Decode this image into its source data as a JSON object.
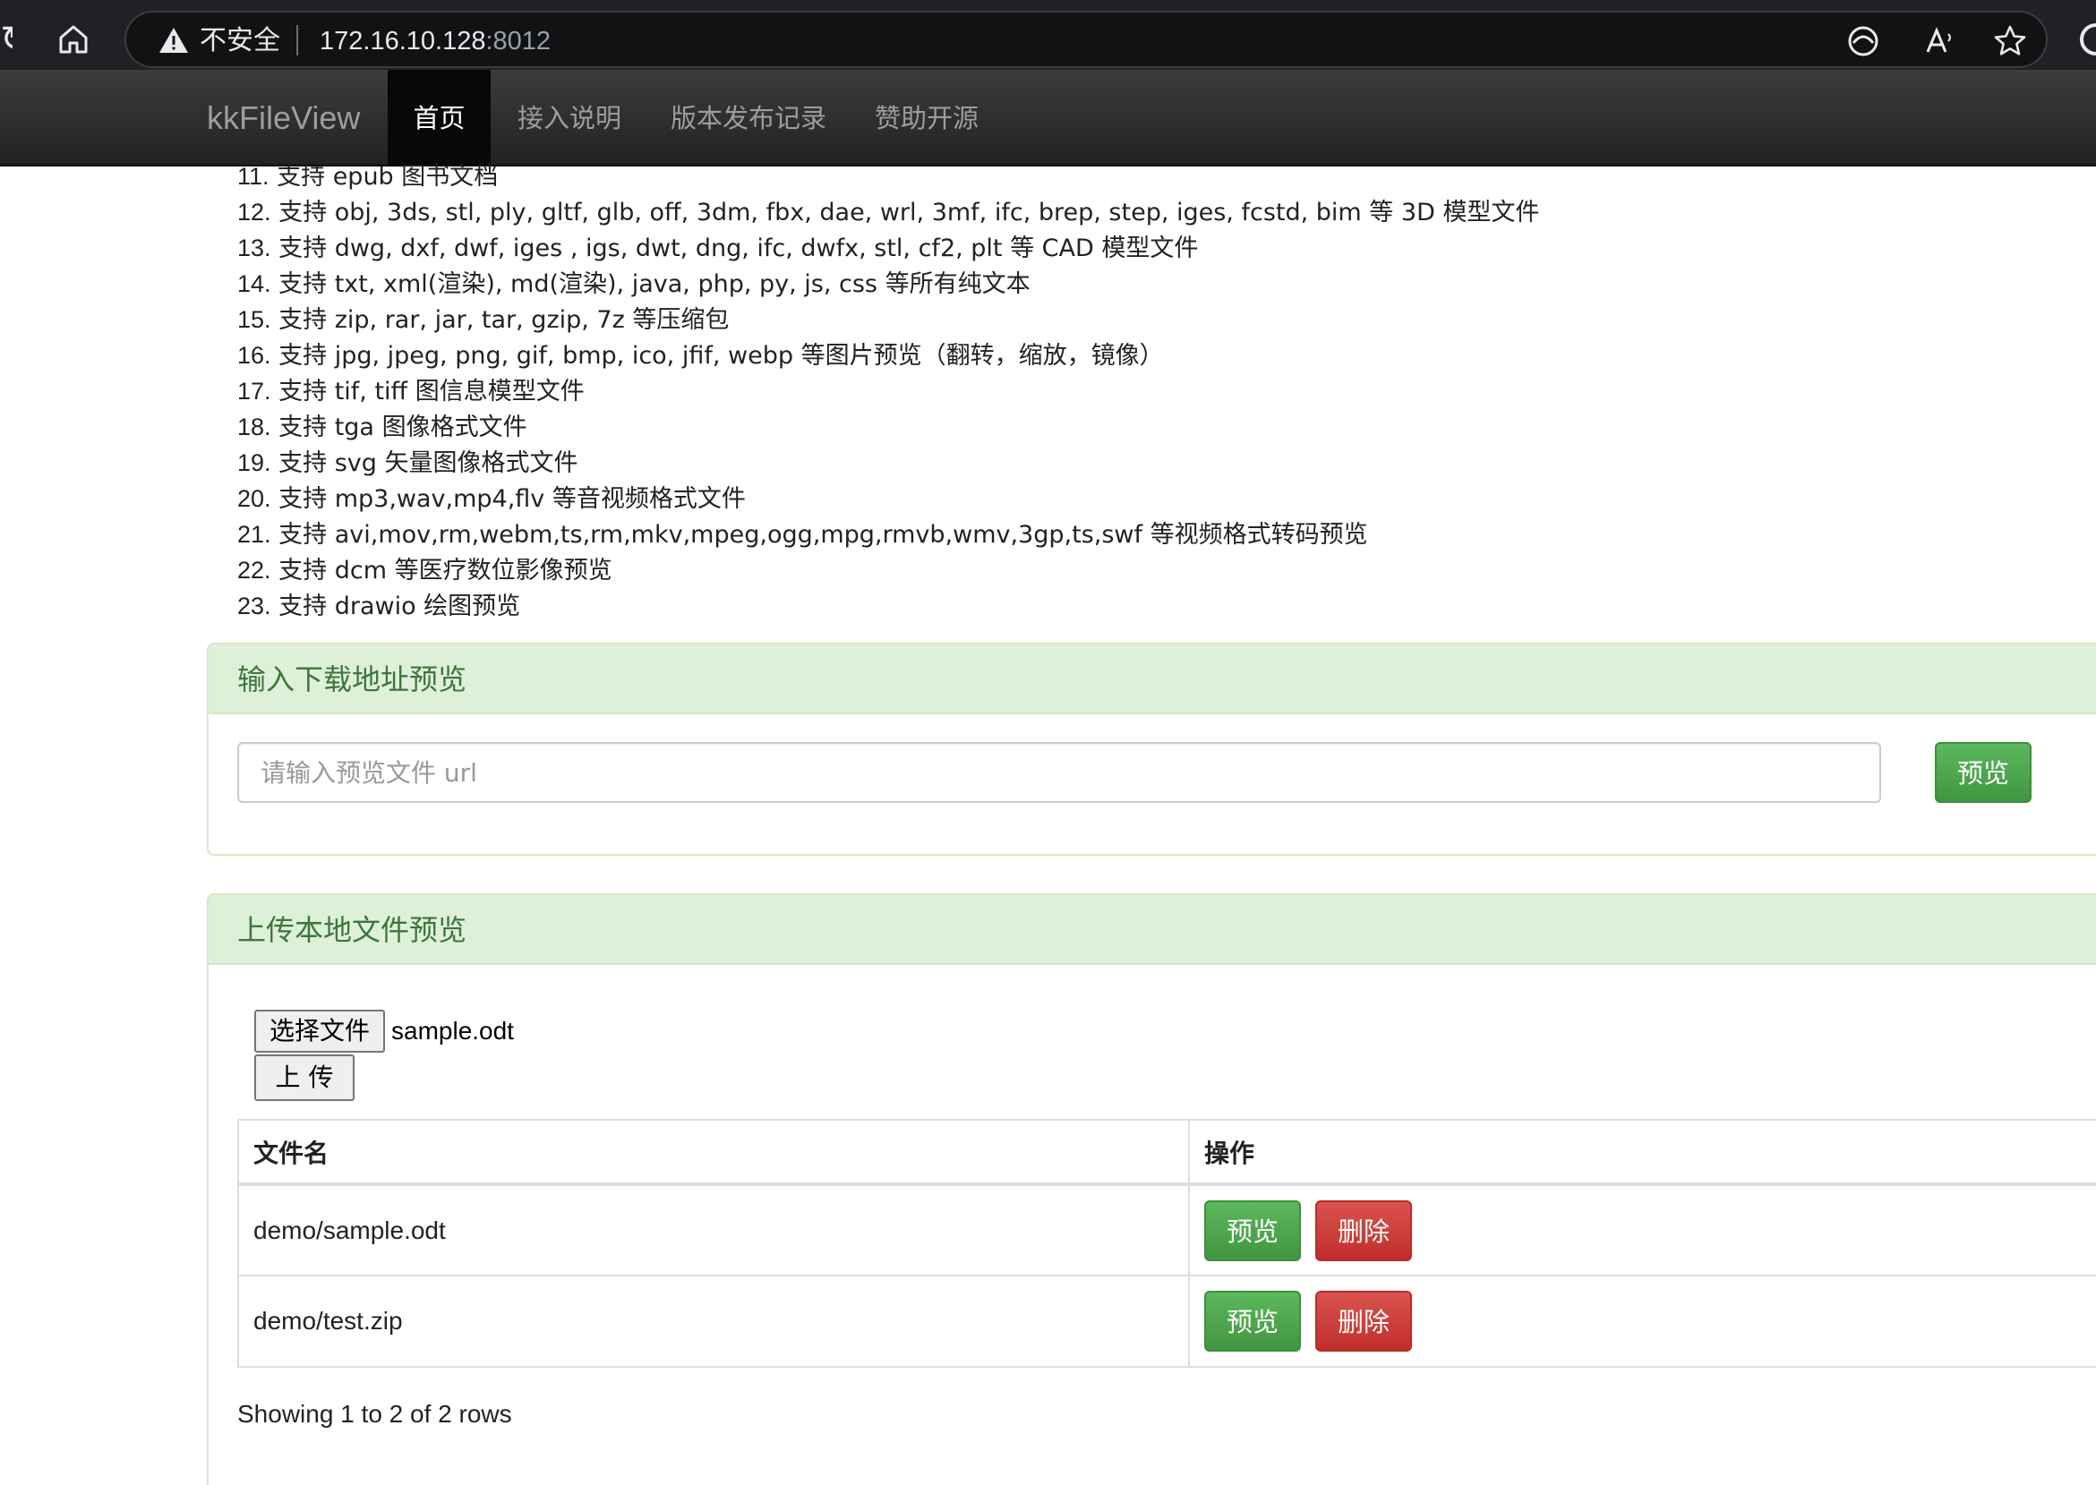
{
  "browser": {
    "security_label": "不安全",
    "url_host": "172.16.10.128",
    "url_port": ":8012"
  },
  "navbar": {
    "brand": "kkFileView",
    "items": [
      {
        "label": "首页",
        "active": true
      },
      {
        "label": "接入说明",
        "active": false
      },
      {
        "label": "版本发布记录",
        "active": false
      },
      {
        "label": "赞助开源",
        "active": false
      }
    ]
  },
  "features": [
    {
      "num": "11.",
      "text": " 支持 epub 图书文档"
    },
    {
      "num": "12.",
      "text": " 支持 obj, 3ds, stl, ply, gltf, glb, off, 3dm, fbx, dae, wrl, 3mf, ifc, brep, step, iges, fcstd, bim 等 3D 模型文件"
    },
    {
      "num": "13.",
      "text": " 支持 dwg, dxf, dwf, iges , igs, dwt, dng, ifc, dwfx, stl, cf2, plt 等 CAD 模型文件"
    },
    {
      "num": "14.",
      "text": " 支持 txt, xml(渲染), md(渲染), java, php, py, js, css 等所有纯文本"
    },
    {
      "num": "15.",
      "text": " 支持 zip, rar, jar, tar, gzip, 7z 等压缩包"
    },
    {
      "num": "16.",
      "text": " 支持 jpg, jpeg, png, gif, bmp, ico, jfif, webp 等图片预览（翻转，缩放，镜像）"
    },
    {
      "num": "17.",
      "text": " 支持 tif, tiff 图信息模型文件"
    },
    {
      "num": "18.",
      "text": " 支持 tga 图像格式文件"
    },
    {
      "num": "19.",
      "text": " 支持 svg 矢量图像格式文件"
    },
    {
      "num": "20.",
      "text": " 支持 mp3,wav,mp4,flv 等音视频格式文件"
    },
    {
      "num": "21.",
      "text": " 支持 avi,mov,rm,webm,ts,rm,mkv,mpeg,ogg,mpg,rmvb,wmv,3gp,ts,swf 等视频格式转码预览"
    },
    {
      "num": "22.",
      "text": " 支持 dcm 等医疗数位影像预览"
    },
    {
      "num": "23.",
      "text": " 支持 drawio 绘图预览"
    }
  ],
  "url_panel": {
    "title": "输入下载地址预览",
    "input_placeholder": "请输入预览文件 url",
    "input_value": "",
    "preview_button": "预览"
  },
  "upload_panel": {
    "title": "上传本地文件预览",
    "choose_file_button": "选择文件",
    "chosen_file_name": "sample.odt",
    "upload_button": "上 传",
    "table": {
      "columns": [
        "文件名",
        "操作"
      ],
      "rows": [
        {
          "file_name": "demo/sample.odt",
          "preview_label": "预览",
          "delete_label": "删除"
        },
        {
          "file_name": "demo/test.zip",
          "preview_label": "预览",
          "delete_label": "删除"
        }
      ]
    },
    "pagination_info": "Showing 1 to 2 of 2 rows"
  },
  "colors": {
    "navbar_bg": "#222222",
    "panel_heading_bg": "#dff0d8",
    "panel_heading_text": "#3c763d",
    "success_button": "#5cb85c",
    "danger_button": "#d9534f"
  }
}
